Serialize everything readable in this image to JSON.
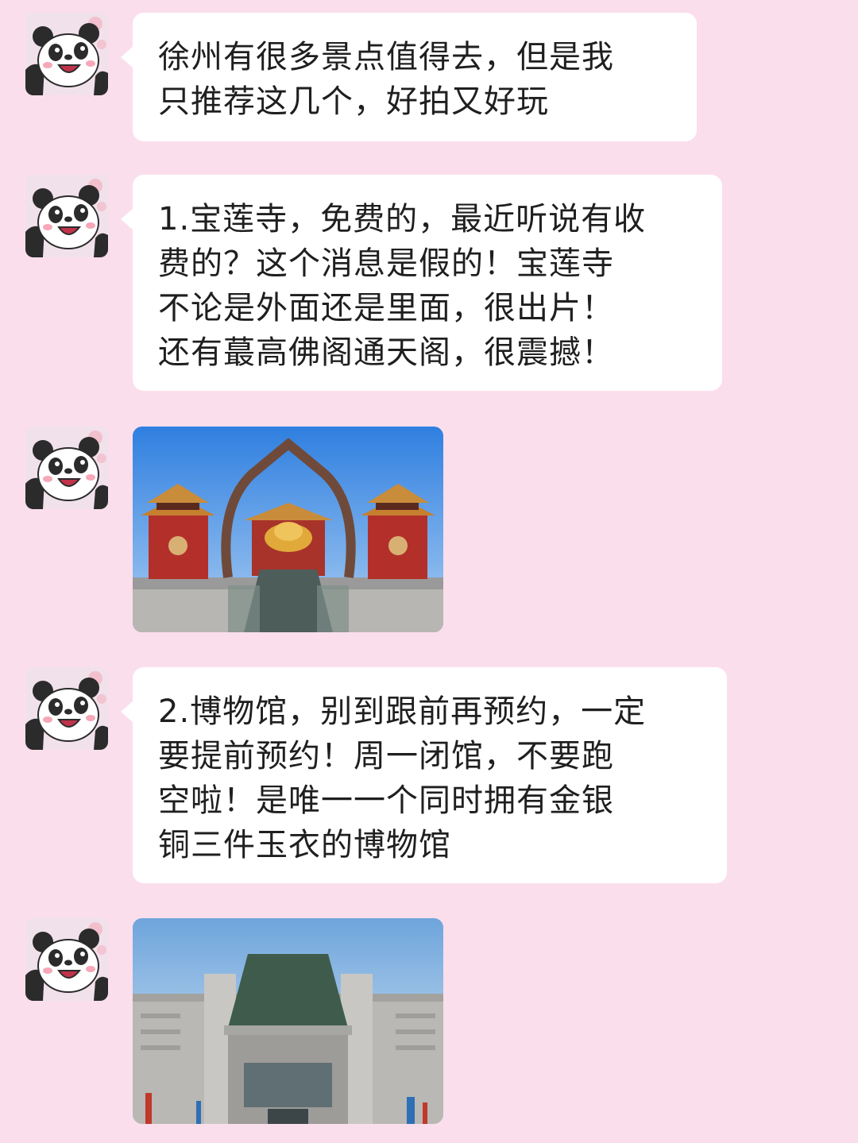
{
  "chat": {
    "messages": [
      {
        "type": "text",
        "avatar_icon": "panda-avatar-icon",
        "text": "徐州有很多景点值得去，但是我\n只推荐这几个，好拍又好玩"
      },
      {
        "type": "text",
        "avatar_icon": "panda-avatar-icon",
        "text": "1.宝莲寺，免费的，最近听说有收\n费的？这个消息是假的！宝莲寺\n不论是外面还是里面，很出片！\n还有蕞高佛阁通天阁，很震撼！"
      },
      {
        "type": "image",
        "avatar_icon": "panda-avatar-icon",
        "image_subject": "temple-gate-photo"
      },
      {
        "type": "text",
        "avatar_icon": "panda-avatar-icon",
        "text": "2.博物馆，别到跟前再预约，一定\n要提前预约！周一闭馆，不要跑\n空啦！是唯一一个同时拥有金银\n铜三件玉衣的博物馆"
      },
      {
        "type": "image",
        "avatar_icon": "panda-avatar-icon",
        "image_subject": "museum-building-photo"
      }
    ]
  },
  "colors": {
    "background": "#fbdeec",
    "bubble": "#ffffff",
    "text": "#1f1f1f"
  }
}
